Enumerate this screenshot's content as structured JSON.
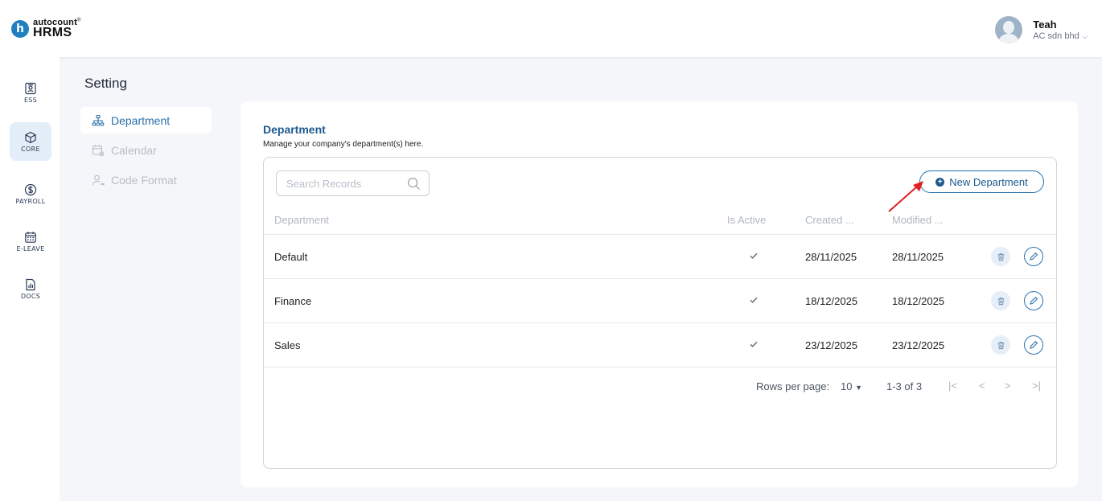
{
  "header": {
    "logo_top": "autocount",
    "logo_bottom": "HRMS",
    "user_name": "Teah",
    "user_company": "AC sdn bhd"
  },
  "rail": {
    "items": [
      {
        "label": "ESS",
        "icon": "id-card-icon"
      },
      {
        "label": "CORE",
        "icon": "cube-icon"
      },
      {
        "label": "PAYROLL",
        "icon": "dollar-icon"
      },
      {
        "label": "E-LEAVE",
        "icon": "calendar-grid-icon"
      },
      {
        "label": "DOCS",
        "icon": "document-chart-icon"
      }
    ],
    "active": "CORE"
  },
  "settings": {
    "title": "Setting",
    "nav": [
      {
        "label": "Department",
        "icon": "org-chart-icon"
      },
      {
        "label": "Calendar",
        "icon": "calendar-gear-icon"
      },
      {
        "label": "Code Format",
        "icon": "user-code-icon"
      }
    ],
    "active": "Department"
  },
  "main": {
    "title": "Department",
    "subtitle": "Manage your company's department(s) here.",
    "search_placeholder": "Search Records",
    "new_button": "New Department",
    "columns": {
      "department": "Department",
      "is_active": "Is Active",
      "created": "Created ...",
      "modified": "Modified ..."
    },
    "rows": [
      {
        "department": "Default",
        "is_active": true,
        "created": "28/11/2025",
        "modified": "28/11/2025"
      },
      {
        "department": "Finance",
        "is_active": true,
        "created": "18/12/2025",
        "modified": "18/12/2025"
      },
      {
        "department": "Sales",
        "is_active": true,
        "created": "23/12/2025",
        "modified": "23/12/2025"
      }
    ],
    "pagination": {
      "rows_per_page_label": "Rows per page:",
      "rows_per_page": "10",
      "range": "1-3 of 3"
    }
  },
  "colors": {
    "brand_blue": "#1d5a8f",
    "active_bg": "#e3eef8",
    "annotation_arrow": "#e02020"
  }
}
